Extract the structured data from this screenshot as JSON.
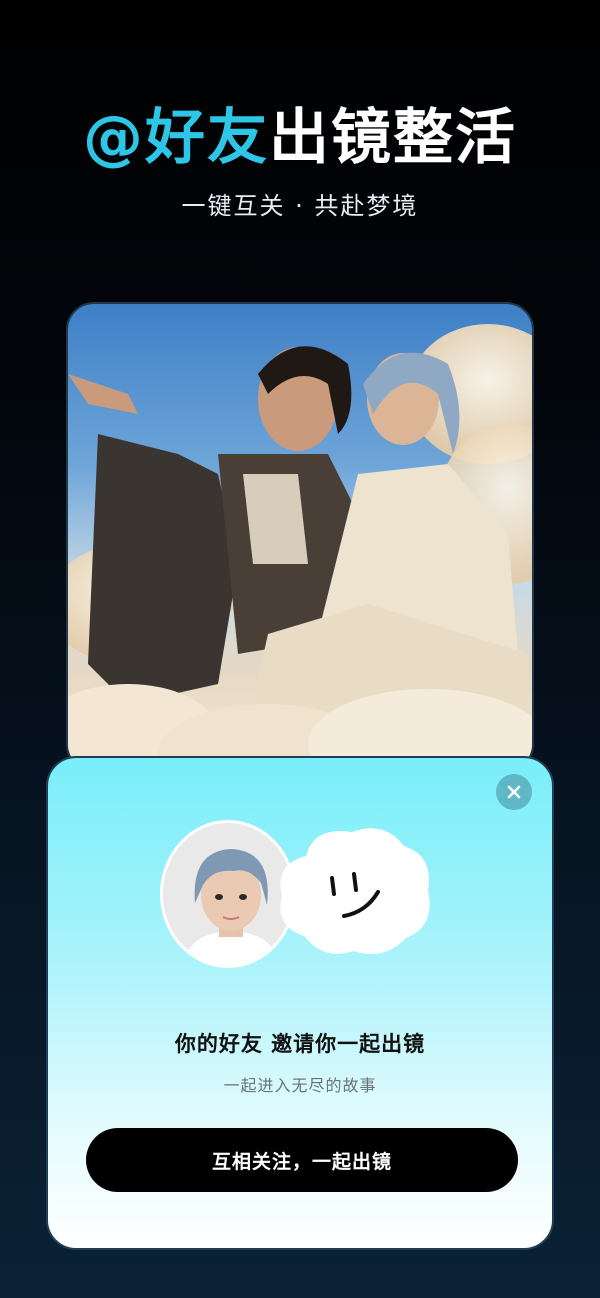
{
  "header": {
    "title_accent": "@好友",
    "title_rest": "出镜整活",
    "subtitle": "一键互关 · 共赴梦境"
  },
  "invite": {
    "title": "你的好友 邀请你一起出镜",
    "subtitle": "一起进入无尽的故事",
    "button_label": "互相关注，一起出镜",
    "close_icon": "close-icon"
  },
  "colors": {
    "accent": "#2ec6e6",
    "button_bg": "#000000",
    "card_top": "#79eef9"
  }
}
